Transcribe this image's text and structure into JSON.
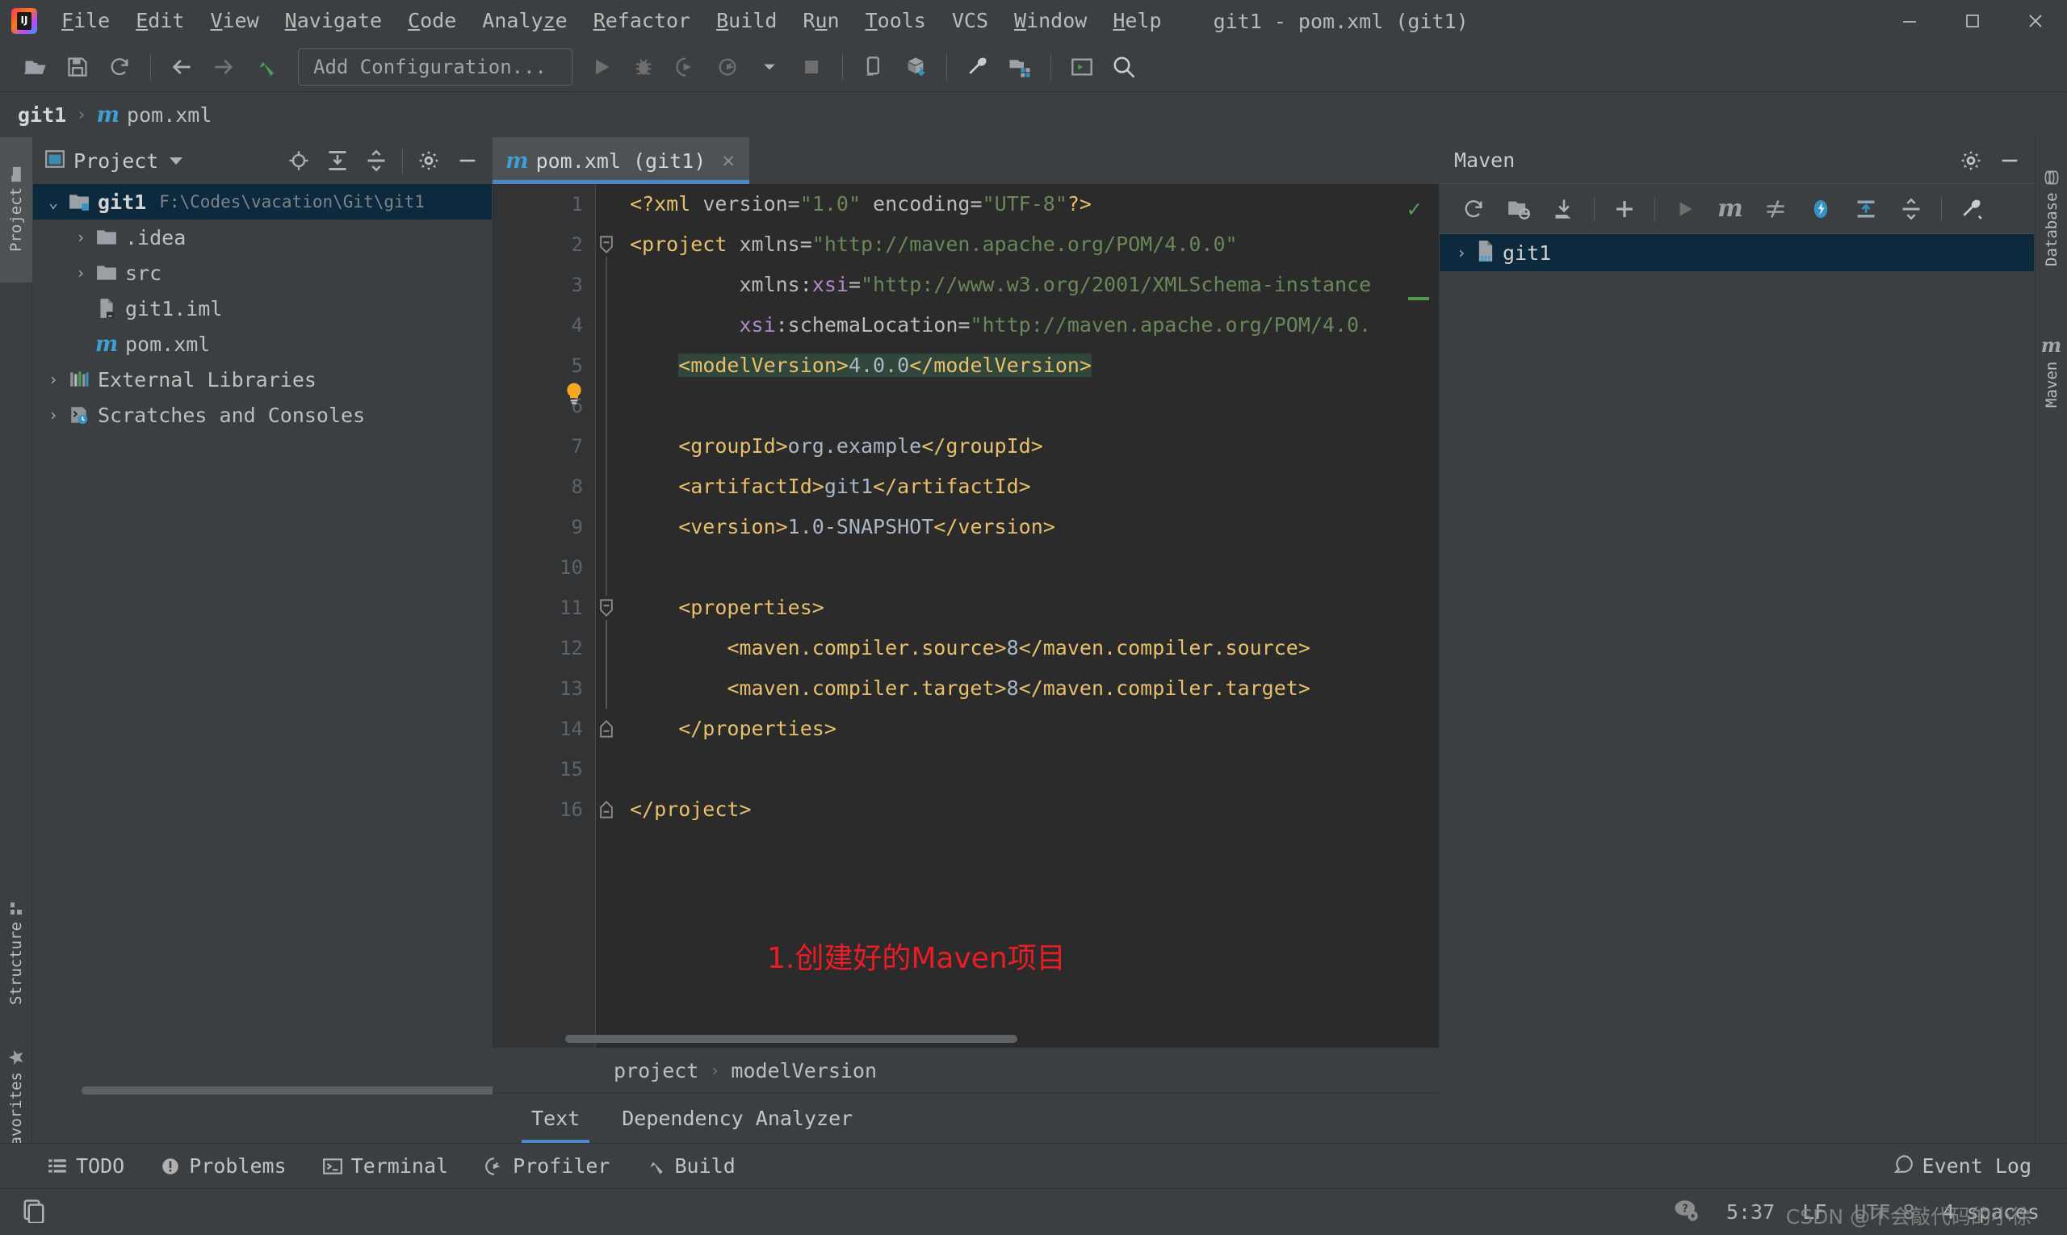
{
  "window": {
    "title": "git1 - pom.xml (git1)",
    "logo_text": "IJ",
    "controls": {
      "minimize": "minimize-icon",
      "maximize": "maximize-icon",
      "close": "close-icon"
    }
  },
  "menubar": [
    {
      "label": "File",
      "mnemonic": "F"
    },
    {
      "label": "Edit",
      "mnemonic": "E"
    },
    {
      "label": "View",
      "mnemonic": "V"
    },
    {
      "label": "Navigate",
      "mnemonic": "N"
    },
    {
      "label": "Code",
      "mnemonic": "C"
    },
    {
      "label": "Analyze",
      "mnemonic": "z"
    },
    {
      "label": "Refactor",
      "mnemonic": "R"
    },
    {
      "label": "Build",
      "mnemonic": "B"
    },
    {
      "label": "Run",
      "mnemonic": "u"
    },
    {
      "label": "Tools",
      "mnemonic": "T"
    },
    {
      "label": "VCS",
      "mnemonic": ""
    },
    {
      "label": "Window",
      "mnemonic": "W"
    },
    {
      "label": "Help",
      "mnemonic": "H"
    }
  ],
  "toolbar": {
    "open_label": "open-project-icon",
    "save_label": "save-all-icon",
    "sync_label": "sync-icon",
    "back_label": "back-icon",
    "forward_label": "forward-icon",
    "build_label": "build-icon",
    "run_config": "Add Configuration...",
    "run_label": "run-icon",
    "debug_label": "debug-icon",
    "run_coverage_label": "run-with-coverage-icon",
    "profile_label": "profile-icon",
    "stop_label": "stop-icon",
    "device_label": "device-manager-icon",
    "sdk_label": "sdk-download-icon",
    "settings_label": "settings-wrench-icon",
    "project_structure_label": "project-structure-icon",
    "terminal_label": "terminal-icon",
    "search_label": "search-everywhere-icon"
  },
  "navbar": {
    "project": "git1",
    "separator": "›",
    "file": "pom.xml",
    "file_icon": "m"
  },
  "rails": {
    "left": [
      {
        "label": "Project",
        "active": true
      },
      {
        "label": "Structure",
        "active": false
      },
      {
        "label": "Favorites",
        "active": false
      }
    ],
    "right": [
      {
        "label": "Database",
        "active": false
      },
      {
        "label": "Maven",
        "active": false
      }
    ]
  },
  "project_panel": {
    "title": "Project",
    "header_icons": [
      "locate-icon",
      "expand-all-icon",
      "collapse-all-icon",
      "gear-icon",
      "hide-icon"
    ],
    "tree": [
      {
        "label": "git1",
        "path": "F:\\Codes\\vacation\\Git\\git1",
        "indent": 0,
        "arrow": "⌄",
        "icon": "module-folder-icon",
        "selected": true,
        "bold": true
      },
      {
        "label": ".idea",
        "path": "",
        "indent": 1,
        "arrow": "›",
        "icon": "folder-icon",
        "selected": false,
        "bold": false
      },
      {
        "label": "src",
        "path": "",
        "indent": 1,
        "arrow": "›",
        "icon": "folder-icon",
        "selected": false,
        "bold": false
      },
      {
        "label": "git1.iml",
        "path": "",
        "indent": 1,
        "arrow": "",
        "icon": "iml-file-icon",
        "selected": false,
        "bold": false
      },
      {
        "label": "pom.xml",
        "path": "",
        "indent": 1,
        "arrow": "",
        "icon": "maven-file-icon",
        "selected": false,
        "bold": false
      },
      {
        "label": "External Libraries",
        "path": "",
        "indent": 0,
        "arrow": "›",
        "icon": "libraries-icon",
        "selected": false,
        "bold": false
      },
      {
        "label": "Scratches and Consoles",
        "path": "",
        "indent": 0,
        "arrow": "›",
        "icon": "scratches-icon",
        "selected": false,
        "bold": false
      }
    ]
  },
  "editor": {
    "tab": {
      "label": "pom.xml (git1)",
      "icon": "m",
      "close": "✕"
    },
    "inspection_status": "✓",
    "annotation": "1.创建好的Maven项目",
    "breadcrumb": {
      "parts": [
        "project",
        "modelVersion"
      ],
      "separator": "›"
    },
    "bottom_tabs": [
      {
        "label": "Text",
        "active": true
      },
      {
        "label": "Dependency Analyzer",
        "active": false
      }
    ],
    "lines": [
      {
        "n": 1,
        "fold": "",
        "bulb": false
      },
      {
        "n": 2,
        "fold": "minus",
        "bulb": false
      },
      {
        "n": 3,
        "fold": "",
        "bulb": false
      },
      {
        "n": 4,
        "fold": "",
        "bulb": false
      },
      {
        "n": 5,
        "fold": "",
        "bulb": true
      },
      {
        "n": 6,
        "fold": "",
        "bulb": false
      },
      {
        "n": 7,
        "fold": "",
        "bulb": false
      },
      {
        "n": 8,
        "fold": "",
        "bulb": false
      },
      {
        "n": 9,
        "fold": "",
        "bulb": false
      },
      {
        "n": 10,
        "fold": "",
        "bulb": false
      },
      {
        "n": 11,
        "fold": "minus",
        "bulb": false
      },
      {
        "n": 12,
        "fold": "",
        "bulb": false
      },
      {
        "n": 13,
        "fold": "",
        "bulb": false
      },
      {
        "n": 14,
        "fold": "end",
        "bulb": false
      },
      {
        "n": 15,
        "fold": "",
        "bulb": false
      },
      {
        "n": 16,
        "fold": "end",
        "bulb": false
      }
    ],
    "code_text": [
      "<?xml version=\"1.0\" encoding=\"UTF-8\"?>",
      "<project xmlns=\"http://maven.apache.org/POM/4.0.0\"",
      "         xmlns:xsi=\"http://www.w3.org/2001/XMLSchema-instance\"",
      "         xsi:schemaLocation=\"http://maven.apache.org/POM/4.0.",
      "    <modelVersion>4.0.0</modelVersion>",
      "",
      "    <groupId>org.example</groupId>",
      "    <artifactId>git1</artifactId>",
      "    <version>1.0-SNAPSHOT</version>",
      "",
      "    <properties>",
      "        <maven.compiler.source>8</maven.compiler.source>",
      "        <maven.compiler.target>8</maven.compiler.target>",
      "    </properties>",
      "",
      "</project>"
    ]
  },
  "maven_panel": {
    "title": "Maven",
    "header_icons": [
      "gear-icon",
      "hide-icon"
    ],
    "toolbar_icons": [
      "reload-all-projects-icon",
      "generate-sources-icon",
      "download-sources-icon",
      "add-maven-project-icon",
      "run-icon",
      "execute-maven-goal-icon",
      "toggle-skip-tests-icon",
      "toggle-offline-icon",
      "expand-all-icon",
      "collapse-all-icon",
      "settings-wrench-icon"
    ],
    "tree": [
      {
        "label": "git1",
        "arrow": "›",
        "icon": "maven-module-icon",
        "selected": true
      }
    ]
  },
  "toolwindow_bar": {
    "items": [
      {
        "label": "TODO",
        "icon": "todo-icon"
      },
      {
        "label": "Problems",
        "icon": "problems-icon"
      },
      {
        "label": "Terminal",
        "icon": "terminal-icon"
      },
      {
        "label": "Profiler",
        "icon": "profiler-icon"
      },
      {
        "label": "Build",
        "icon": "build-icon"
      }
    ],
    "event_log": {
      "label": "Event Log",
      "icon": "event-log-icon"
    }
  },
  "statusbar": {
    "left_icon": "memory-indicator-icon",
    "help_icon": "help-icon",
    "caret_position": "5:37",
    "line_separator": "LF",
    "encoding": "UTF-8",
    "indent": "4 spaces",
    "watermark": "CSDN @不会敲代码的小徐"
  },
  "colors": {
    "accent": "#4a88c7",
    "selection": "#0d293e",
    "panel_bg": "#3c3f41",
    "editor_bg": "#2b2b2b",
    "annotation_red": "#ec1c24",
    "tag": "#e8bf6a",
    "string": "#6a8759",
    "text": "#a9b7c6"
  }
}
